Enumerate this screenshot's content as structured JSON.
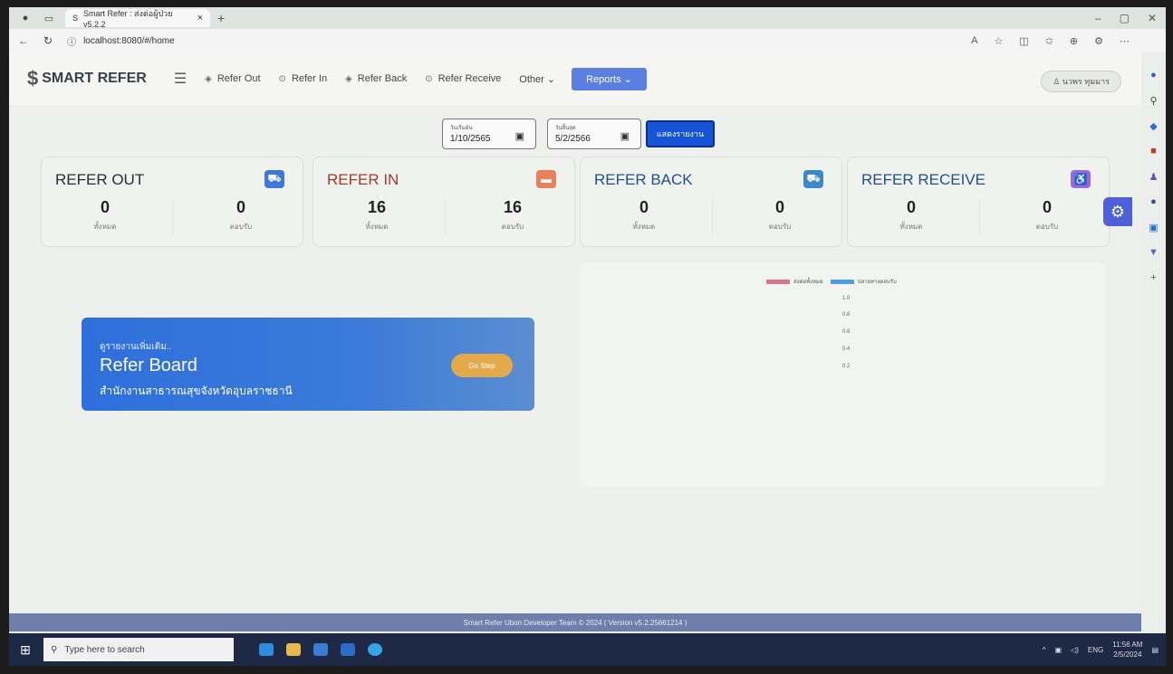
{
  "browser": {
    "tab_title": "Smart Refer : ส่งต่อผู้ป่วย v5.2.2",
    "tab_close": "×",
    "new_tab": "+",
    "url": "localhost:8080/#/home",
    "window_controls": [
      "–",
      "▢",
      "✕"
    ]
  },
  "header": {
    "brand": "SMART REFER",
    "nav": [
      {
        "label": "Refer Out",
        "icon": "diamond-arrow-icon"
      },
      {
        "label": "Refer In",
        "icon": "circle-arrow-icon"
      },
      {
        "label": "Refer Back",
        "icon": "diamond-arrow-icon"
      },
      {
        "label": "Refer Receive",
        "icon": "circle-check-icon"
      }
    ],
    "other": "Other ⌄",
    "reports": "Reports ⌄",
    "user": "นวพร ทุมมาร"
  },
  "filter": {
    "start_label": "วันเริ่มต้น",
    "start_value": "1/10/2565",
    "end_label": "วันสิ้นสุด",
    "end_value": "5/2/2566",
    "show_button": "แสดงรายงาน"
  },
  "cards": [
    {
      "title": "REFER OUT",
      "title_color": "#2b2d33",
      "icon_color": "#3f79d8",
      "total": "0",
      "total_label": "ทั้งหมด",
      "accepted": "0",
      "accepted_label": "ตอบรับ"
    },
    {
      "title": "REFER IN",
      "title_color": "#a23b2a",
      "icon_color": "#e8805b",
      "total": "16",
      "total_label": "ทั้งหมด",
      "accepted": "16",
      "accepted_label": "ตอบรับ"
    },
    {
      "title": "REFER BACK",
      "title_color": "#1f4f8e",
      "icon_color": "#3c88c9",
      "total": "0",
      "total_label": "ทั้งหมด",
      "accepted": "0",
      "accepted_label": "ตอบรับ"
    },
    {
      "title": "REFER RECEIVE",
      "title_color": "#1f4f8e",
      "icon_color": "#9b6ad6",
      "total": "0",
      "total_label": "ทั้งหมด",
      "accepted": "0",
      "accepted_label": "ตอบรับ"
    }
  ],
  "banner": {
    "subtitle": "ดูรายงานเพิ่มเติม..",
    "title": "Refer Board",
    "org": "สำนักงานสาธารณสุขจังหวัดอุบลราชธานี",
    "button": "Go Step"
  },
  "chart_data": {
    "type": "bar",
    "categories": [],
    "series": [
      {
        "name": "ส่งต่อทั้งหมด",
        "color": "#d9758c",
        "values": []
      },
      {
        "name": "ปลายทางตอบรับ",
        "color": "#4f9ee0",
        "values": []
      }
    ],
    "yticks": [
      "1.0",
      "0.8",
      "0.6",
      "0.4",
      "0.2"
    ],
    "ylim": [
      0,
      1
    ]
  },
  "footer": "Smart Refer Ubon Developer Team © 2024 ( Version v5.2.25661214 )",
  "taskbar": {
    "search_placeholder": "Type here to search",
    "lang": "ENG",
    "time": "11:56 AM",
    "date": "2/5/2024"
  }
}
